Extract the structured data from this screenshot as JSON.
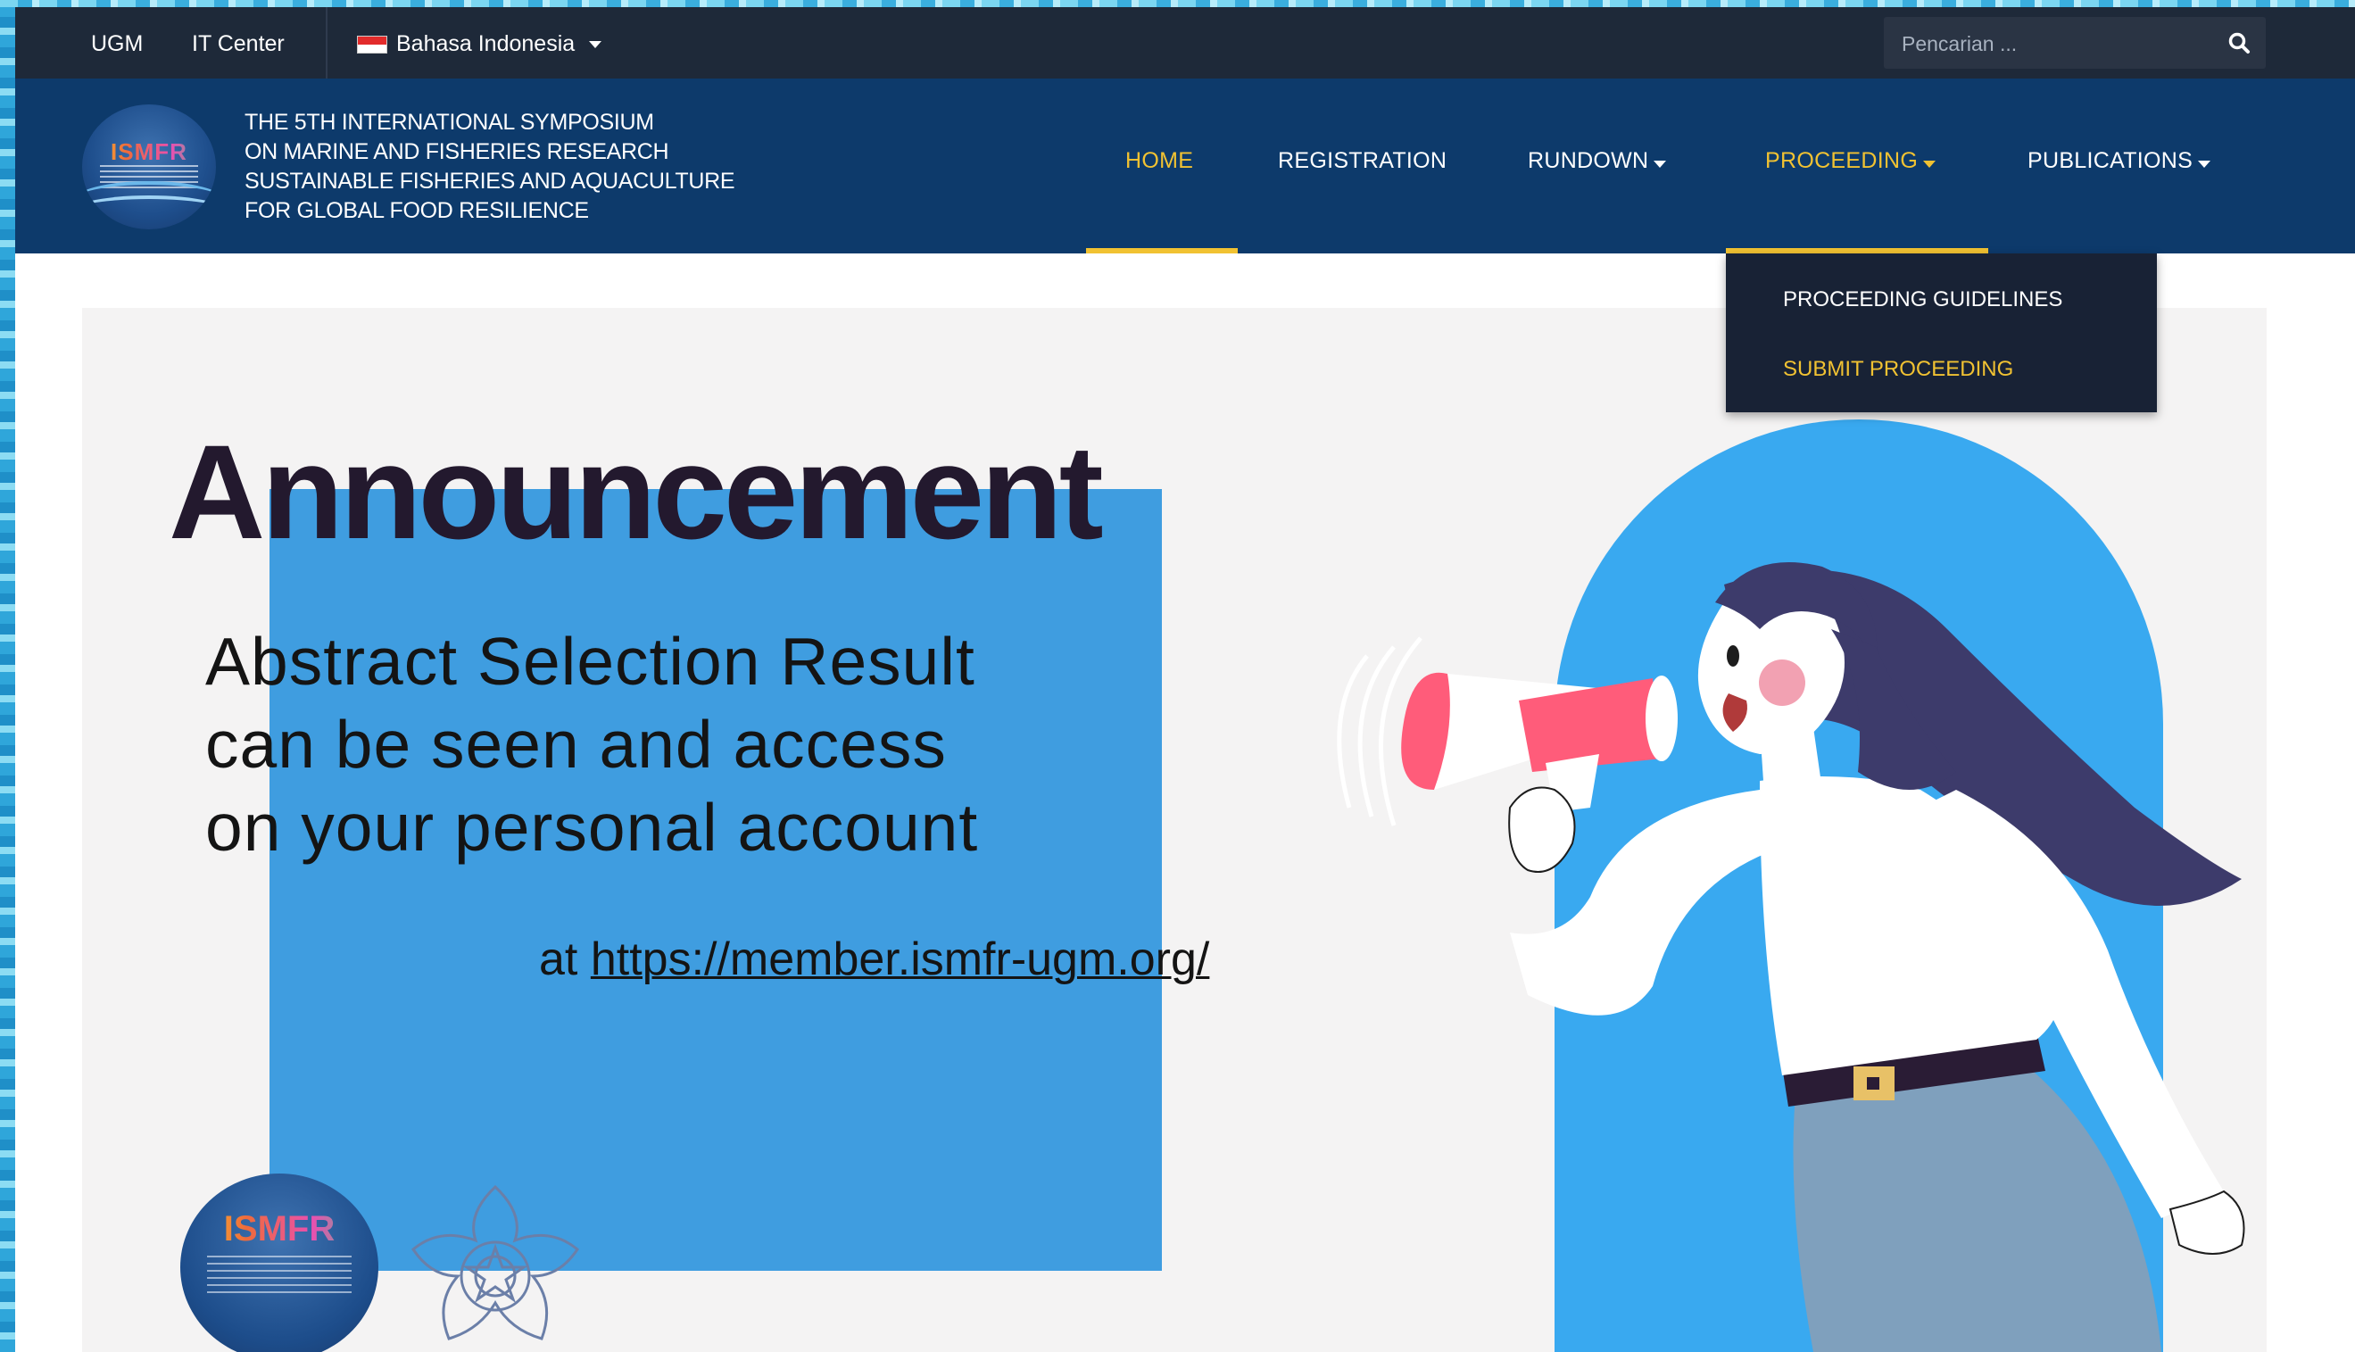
{
  "topbar": {
    "links": [
      "UGM",
      "IT Center"
    ],
    "language": "Bahasa Indonesia",
    "search_placeholder": "Pencarian ..."
  },
  "header": {
    "logo_text": "ISMFR",
    "title_lines": [
      "THE 5TH INTERNATIONAL SYMPOSIUM",
      "ON MARINE AND FISHERIES RESEARCH",
      "SUSTAINABLE FISHERIES AND AQUACULTURE",
      "FOR GLOBAL FOOD RESILIENCE"
    ],
    "nav": [
      {
        "label": "HOME",
        "active": true
      },
      {
        "label": "REGISTRATION",
        "active": false
      },
      {
        "label": "RUNDOWN",
        "active": false,
        "dropdown": true
      },
      {
        "label": "PROCEEDING",
        "active": true,
        "dropdown": true
      },
      {
        "label": "PUBLICATIONS",
        "active": false,
        "dropdown": true
      }
    ]
  },
  "dropdown": {
    "items": [
      {
        "label": "PROCEEDING GUIDELINES",
        "highlighted": false
      },
      {
        "label": "SUBMIT PROCEEDING",
        "highlighted": true
      }
    ]
  },
  "banner": {
    "headline": "Announcement",
    "subtext_lines": [
      "Abstract Selection Result",
      "can be seen and access",
      "on your personal account"
    ],
    "url_prefix": "at",
    "url": "https://member.ismfr-ugm.org/",
    "logo_text": "ISMFR"
  },
  "colors": {
    "topbar_bg": "#1e2939",
    "header_bg": "#0d3a6b",
    "accent": "#f1c232",
    "banner_blue": "#3f9de0",
    "arch_blue": "#39a9f0"
  }
}
